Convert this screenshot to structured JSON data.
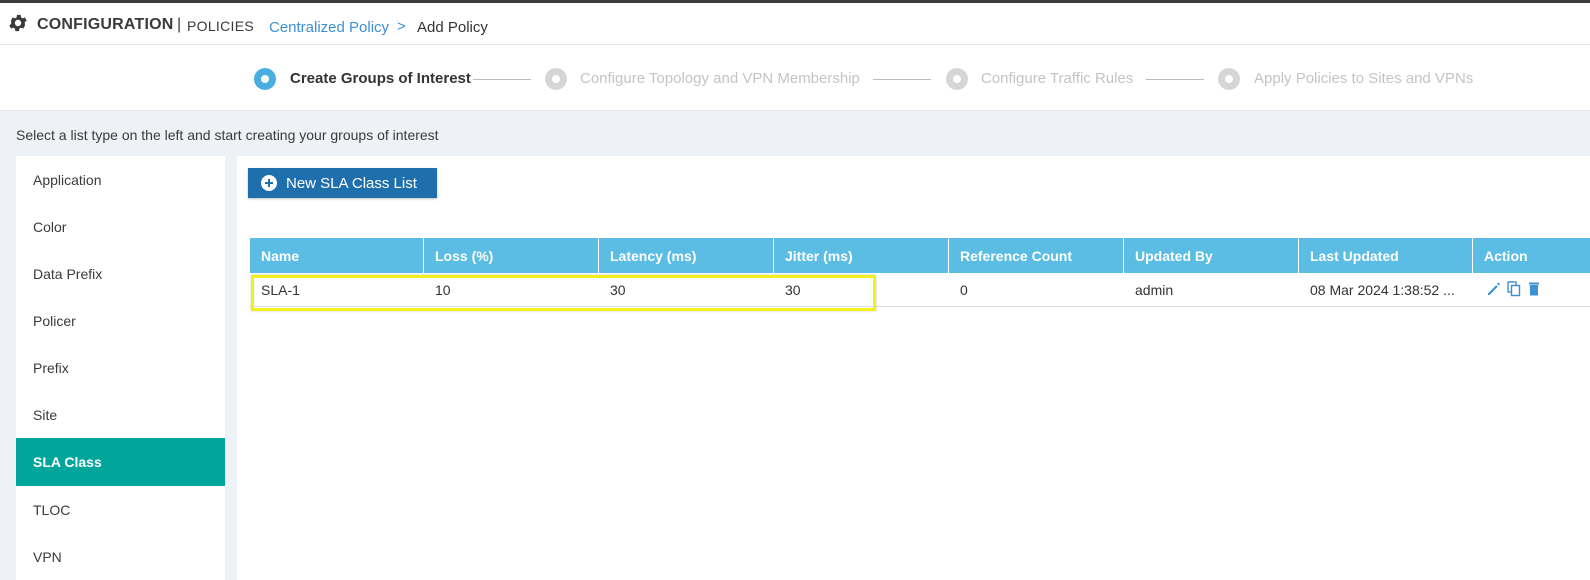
{
  "header": {
    "title": "CONFIGURATION",
    "separator": "|",
    "subtitle": "POLICIES",
    "breadcrumb_link": "Centralized Policy",
    "breadcrumb_arrow": ">",
    "breadcrumb_current": "Add Policy"
  },
  "wizard": {
    "steps": [
      {
        "label": "Create Groups of Interest",
        "state": "active"
      },
      {
        "label": "Configure Topology and VPN Membership",
        "state": "inactive"
      },
      {
        "label": "Configure Traffic Rules",
        "state": "inactive"
      },
      {
        "label": "Apply Policies to Sites and VPNs",
        "state": "inactive"
      }
    ]
  },
  "instructions": "Select a list type on the left and start creating your groups of interest",
  "list_types": {
    "items": [
      {
        "label": "Application"
      },
      {
        "label": "Color"
      },
      {
        "label": "Data Prefix"
      },
      {
        "label": "Policer"
      },
      {
        "label": "Prefix"
      },
      {
        "label": "Site"
      },
      {
        "label": "SLA Class"
      },
      {
        "label": "TLOC"
      },
      {
        "label": "VPN"
      }
    ],
    "selected": "SLA Class"
  },
  "toolbar": {
    "new_button_label": "New SLA Class List"
  },
  "table": {
    "columns": [
      "Name",
      "Loss (%)",
      "Latency (ms)",
      "Jitter (ms)",
      "Reference Count",
      "Updated By",
      "Last Updated",
      "Action"
    ],
    "rows": [
      [
        "SLA-1",
        "10",
        "30",
        "30",
        "0",
        "admin",
        "08 Mar 2024 1:38:52 ..."
      ]
    ]
  },
  "colors": {
    "accent_blue": "#1f6fad",
    "table_header": "#5bbce4",
    "selected_teal": "#00a69c",
    "link_blue": "#3d8fd6",
    "highlight_yellow": "#f0f020",
    "action_icon": "#3d8fd6"
  },
  "icons": {
    "header": "gear-icon",
    "new_button": "plus-circle-icon",
    "actions": [
      "pencil-icon",
      "copy-icon",
      "trash-icon"
    ]
  }
}
